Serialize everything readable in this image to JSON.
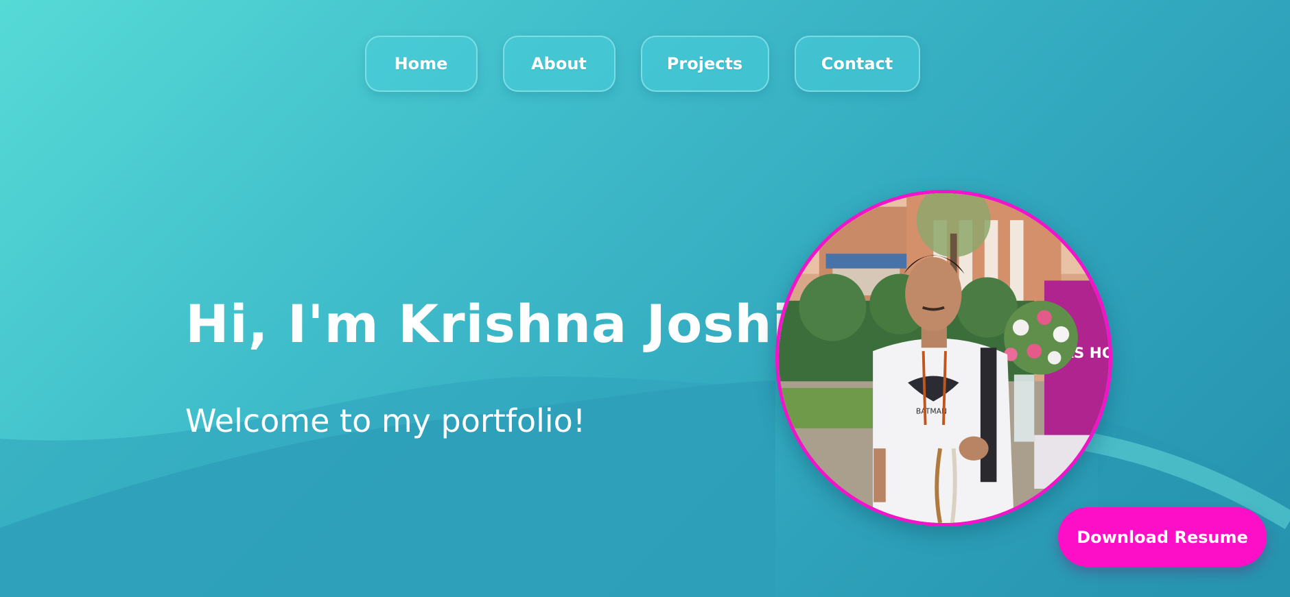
{
  "nav": {
    "items": [
      {
        "label": "Home"
      },
      {
        "label": "About"
      },
      {
        "label": "Projects"
      },
      {
        "label": "Contact"
      }
    ]
  },
  "hero": {
    "title": "Hi, I'm Krishna Joshi",
    "subtitle": "Welcome to my portfolio!"
  },
  "profile": {
    "shirt_text": "BATMAN",
    "banner_text": "L AS HOLA"
  },
  "actions": {
    "resume_label": "Download Resume"
  },
  "colors": {
    "accent": "#fc0fc6",
    "ring": "#f214c8",
    "background_start": "#56dad6",
    "background_end": "#2591ae"
  }
}
